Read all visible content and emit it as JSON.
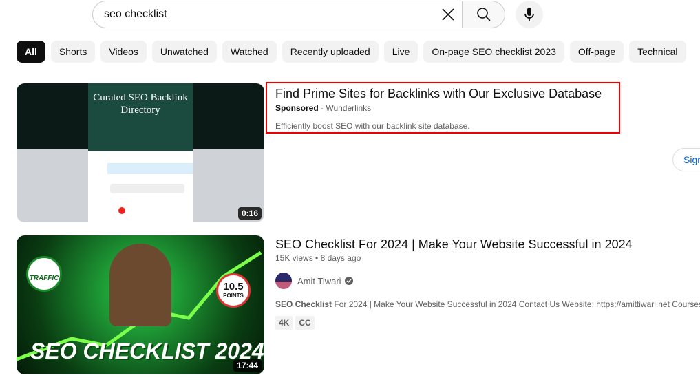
{
  "search": {
    "value": "seo checklist"
  },
  "chips": [
    "All",
    "Shorts",
    "Videos",
    "Unwatched",
    "Watched",
    "Recently uploaded",
    "Live",
    "On-page SEO checklist 2023",
    "Off-page",
    "Technical"
  ],
  "ad": {
    "title": "Find Prime Sites for Backlinks with Our Exclusive Database",
    "sponsored": "Sponsored",
    "advertiser": "Wunderlinks",
    "description": "Efficiently boost SEO with our backlink site database.",
    "duration": "0:16",
    "thumb_title": "Curated SEO Backlink Directory",
    "sign_label": "Sign up",
    "highlight_color": "#e00000"
  },
  "video": {
    "title": "SEO Checklist For 2024 | Make Your Website Successful in 2024",
    "views": "15K views",
    "age": "8 days ago",
    "channel": "Amit Tiwari",
    "desc_bold": "SEO Checklist",
    "desc_rest": " For 2024 | Make Your Website Successful in 2024 Contact Us Website: https://amittiwari.net Courses:",
    "badges": [
      "4K",
      "CC"
    ],
    "duration": "17:44",
    "thumb_text": "SEO CHECKLIST 2024",
    "thumb_traffic": "TRAFFIC",
    "thumb_points": "10.5",
    "thumb_points_label": "POINTS"
  }
}
